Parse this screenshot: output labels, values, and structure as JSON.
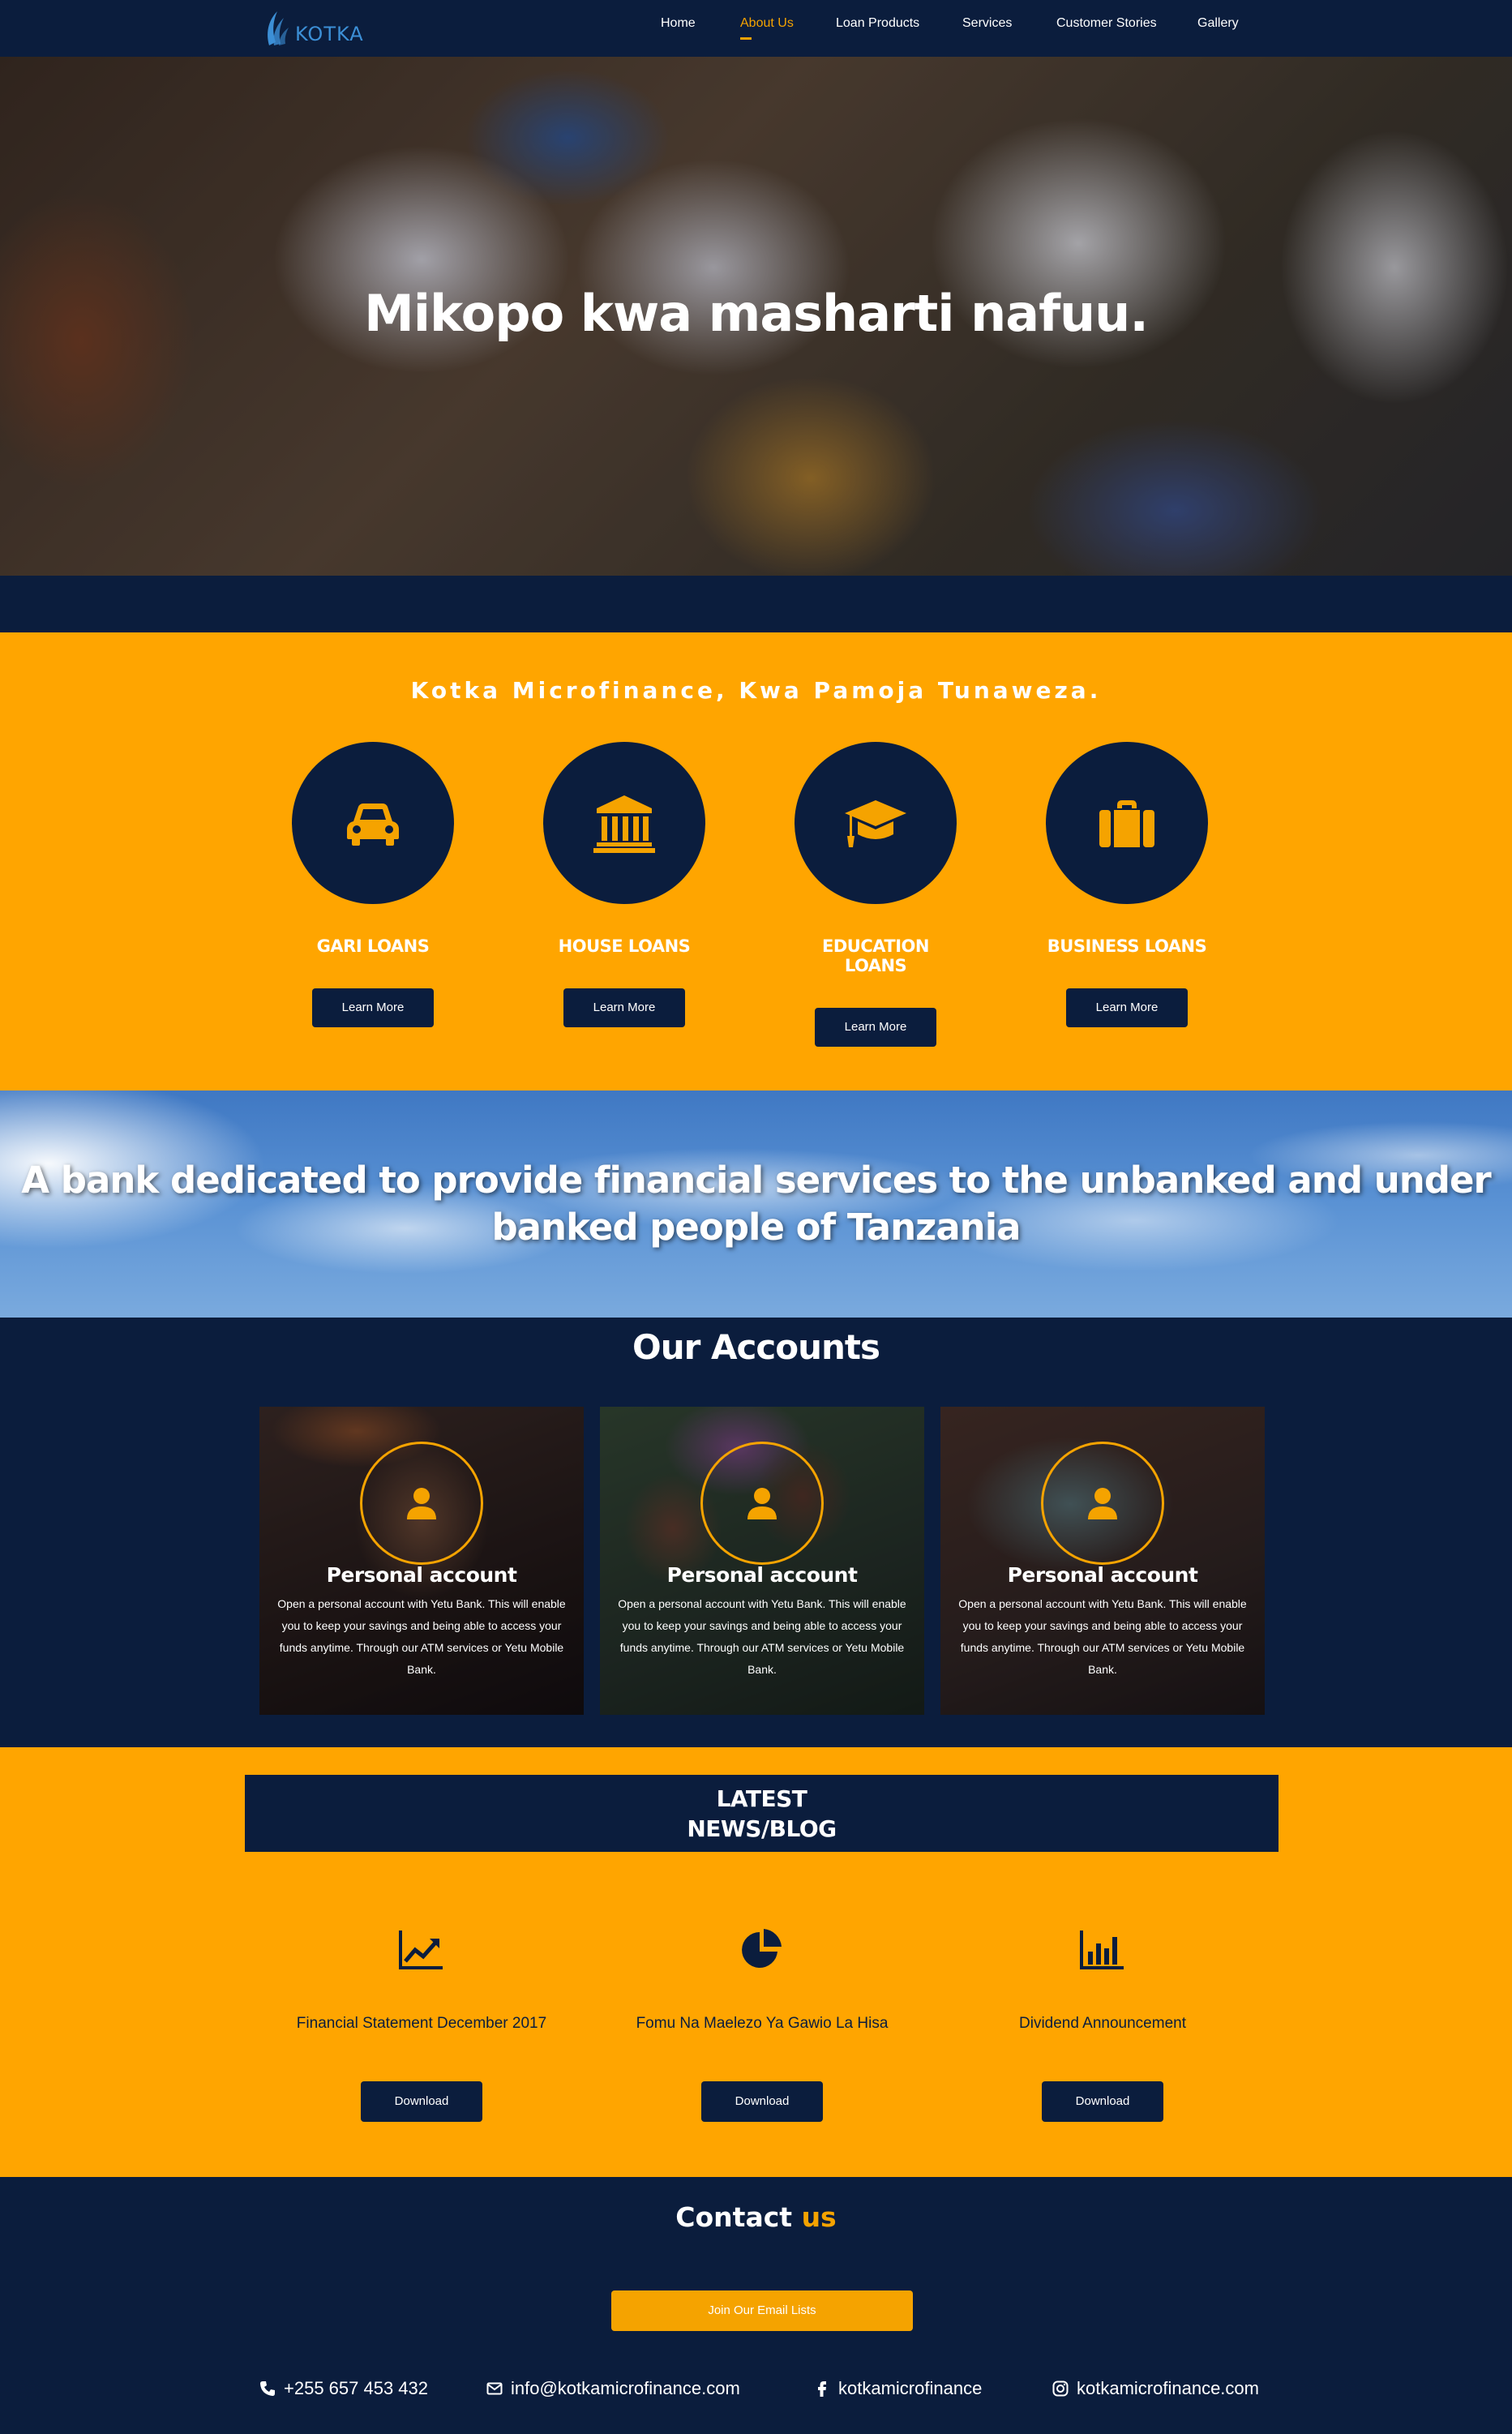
{
  "nav": {
    "brand": "KOTKA",
    "links": [
      {
        "label": "Home",
        "active": false
      },
      {
        "label": "About Us",
        "active": true
      },
      {
        "label": "Loan Products",
        "active": false
      },
      {
        "label": "Services",
        "active": false
      },
      {
        "label": "Customer Stories",
        "active": false
      },
      {
        "label": "Gallery",
        "active": false
      }
    ]
  },
  "hero": {
    "title": "Mikopo kwa masharti nafuu."
  },
  "loans": {
    "title": "Kotka Microfinance, Kwa Pamoja Tunaweza.",
    "items": [
      {
        "label": "GARI LOANS",
        "icon": "car-icon",
        "button": "Learn More"
      },
      {
        "label": "HOUSE LOANS",
        "icon": "bank-icon",
        "button": "Learn More"
      },
      {
        "label": "EDUCATION LOANS",
        "icon": "graduation-cap-icon",
        "button": "Learn More"
      },
      {
        "label": "BUSINESS LOANS",
        "icon": "briefcase-icon",
        "button": "Learn More"
      }
    ]
  },
  "banner": {
    "text": "A bank dedicated to provide financial services to the unbanked and under banked people of Tanzania"
  },
  "accounts": {
    "title": "Our Accounts",
    "items": [
      {
        "title": "Personal account",
        "description": "Open a personal account with Yetu Bank. This will enable you to keep your savings and being able to access your funds anytime. Through our ATM services or Yetu Mobile Bank.",
        "icon": "user-icon"
      },
      {
        "title": "Personal account",
        "description": "Open a personal account with Yetu Bank. This will enable you to keep your savings and being able to access your funds anytime. Through our ATM services or Yetu Mobile Bank.",
        "icon": "user-icon"
      },
      {
        "title": "Personal account",
        "description": "Open a personal account with Yetu Bank. This will enable you to keep your savings and being able to access your funds anytime. Through our ATM services or Yetu Mobile Bank.",
        "icon": "user-icon"
      }
    ]
  },
  "news": {
    "title_line1": "LATEST",
    "title_line2": "NEWS/BLOG",
    "items": [
      {
        "label": "Financial Statement December 2017",
        "icon": "line-chart-icon",
        "button": "Download"
      },
      {
        "label": "Fomu Na Maelezo Ya Gawio La Hisa",
        "icon": "pie-chart-icon",
        "button": "Download"
      },
      {
        "label": "Dividend Announcement",
        "icon": "bar-chart-icon",
        "button": "Download"
      }
    ]
  },
  "contact": {
    "title": "Contact",
    "title_highlight": "us",
    "join_button": "Join Our Email Lists",
    "phone": "+255 657 453 432",
    "email": "info@kotkamicrofinance.com",
    "facebook": "kotkamicrofinance",
    "instagram": "kotkamicrofinance.com"
  },
  "colors": {
    "navy": "#0b1d3d",
    "accent": "#ffa500"
  }
}
